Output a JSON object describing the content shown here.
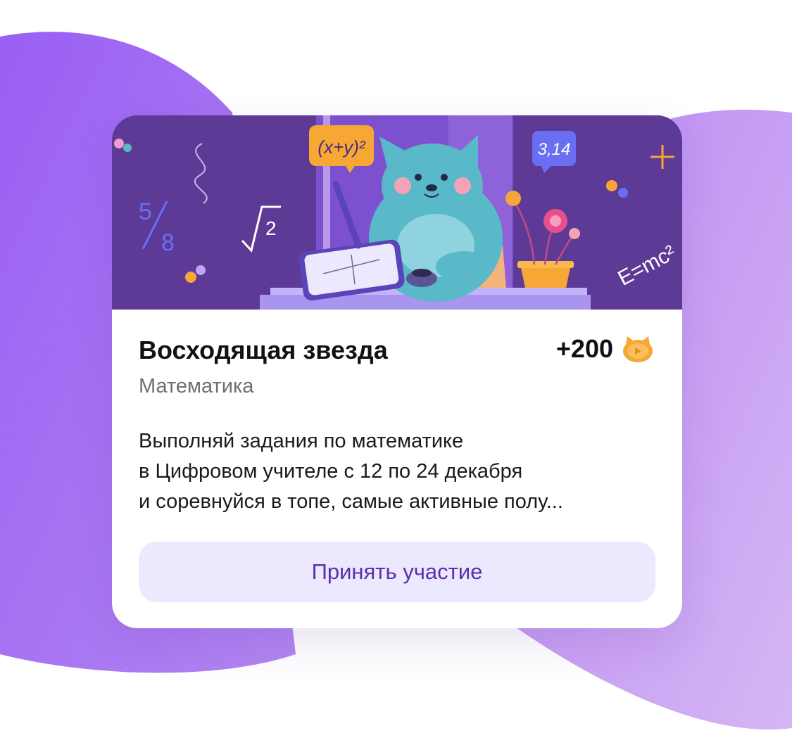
{
  "colors": {
    "background_blob_left": "#a065f2",
    "background_blob_right": "#c39cf0",
    "banner_background": "#5c3a96",
    "button_background": "#ece8fd",
    "button_text": "#5a2fb0",
    "coin": "#f7a734"
  },
  "banner": {
    "bubble_formula": "(x+y)²",
    "bubble_number": "3,14",
    "chalk_fraction_top": "5",
    "chalk_fraction_bottom": "8",
    "chalk_root": "2",
    "chalk_energy": "E=mc²",
    "icons": [
      "cat-mascot",
      "tablet",
      "flower-pot",
      "butterfly",
      "plus-sparkle"
    ]
  },
  "card": {
    "title": "Восходящая звезда",
    "reward_value": "+200",
    "reward_icon": "cat-coin-icon",
    "subject": "Математика",
    "description_lines": [
      "Выполняй задания по математике",
      "в Цифровом учителе с 12 по 24 декабря",
      "и соревнуйся в топе, самые активные полу..."
    ],
    "button_label": "Принять участие"
  }
}
